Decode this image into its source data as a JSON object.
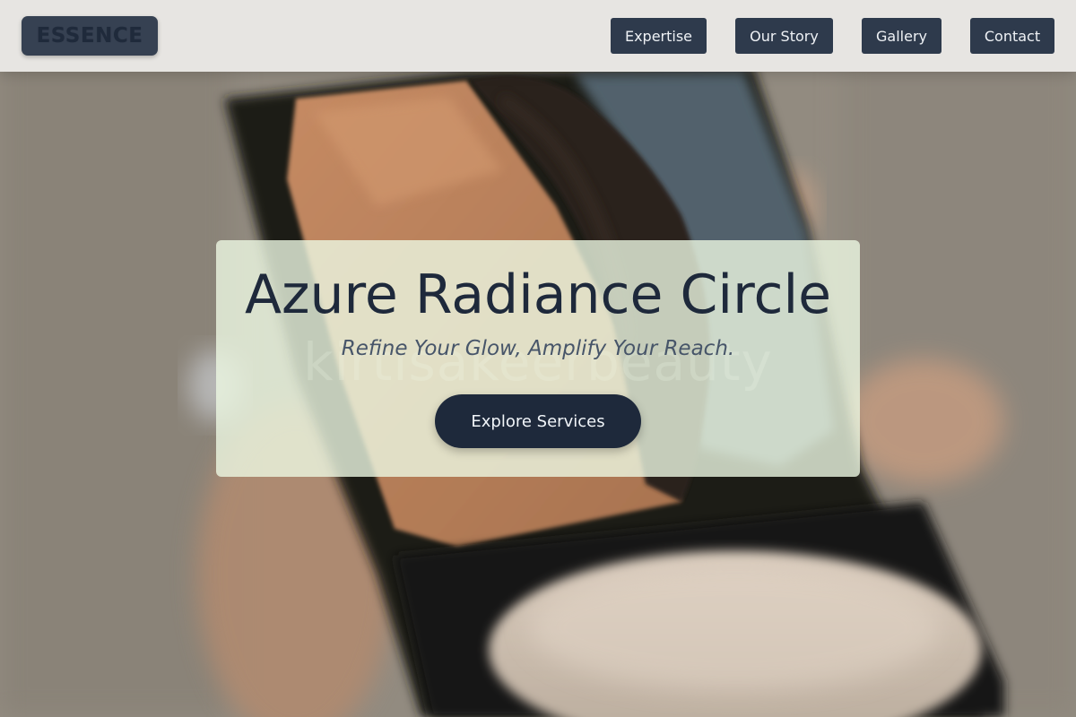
{
  "header": {
    "logo": "ESSENCE",
    "nav": [
      {
        "label": "Expertise"
      },
      {
        "label": "Our Story"
      },
      {
        "label": "Gallery"
      },
      {
        "label": "Contact"
      }
    ]
  },
  "hero": {
    "title": "Azure Radiance Circle",
    "subtitle": "Refine Your Glow, Amplify Your Reach.",
    "cta_label": "Explore Services",
    "background_watermark": "kirtisakeerbeauty"
  },
  "colors": {
    "header_bg": "#e7e5e2",
    "nav_button_bg": "#2e3a4c",
    "logo_bg": "#364152",
    "card_bg": "#ecf8e2",
    "title_text": "#1e293b",
    "subtitle_text": "#475569",
    "cta_bg": "#1e293b"
  }
}
